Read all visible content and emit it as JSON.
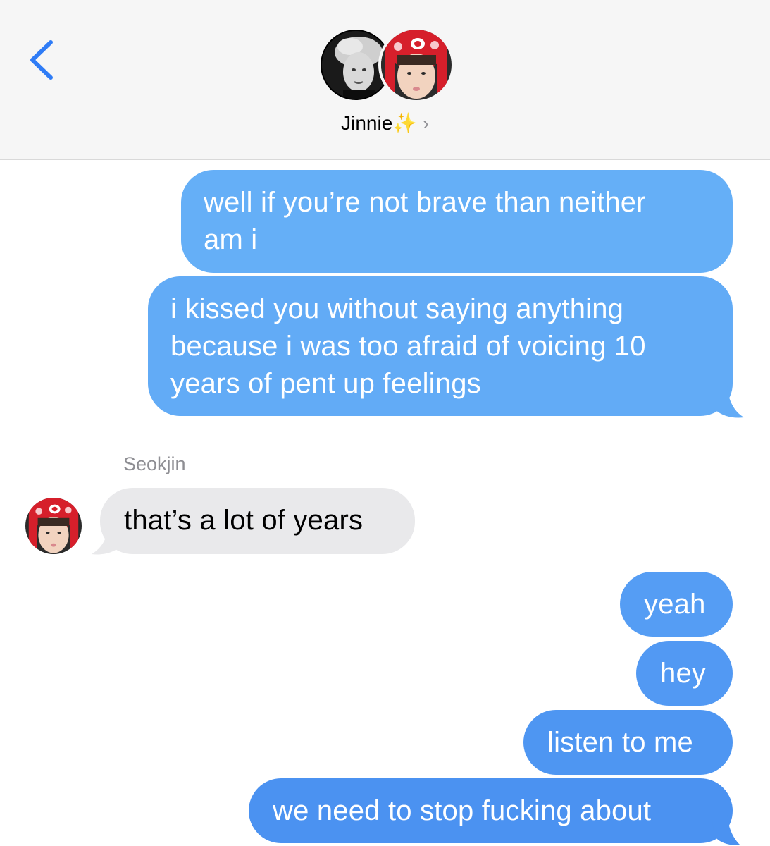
{
  "header": {
    "contact_name": "Jinnie",
    "contact_emoji": "✨",
    "chevron": "›",
    "back_icon": "chevron-left-icon",
    "accent_color": "#2f7cf6"
  },
  "messages": [
    {
      "direction": "outgoing",
      "lines": [
        "well if you’re not brave than neither",
        "am i"
      ],
      "color": "#65aff7"
    },
    {
      "direction": "outgoing",
      "lines": [
        "i kissed you without saying anything",
        "because i was too afraid of voicing 10",
        "years of pent up feelings"
      ],
      "color": "#62abf6"
    },
    {
      "direction": "incoming",
      "sender": "Seokjin",
      "lines": [
        "that’s a lot of years"
      ]
    },
    {
      "direction": "outgoing",
      "lines": [
        "yeah"
      ],
      "color": "#559df4"
    },
    {
      "direction": "outgoing",
      "lines": [
        "hey"
      ],
      "color": "#5299f3"
    },
    {
      "direction": "outgoing",
      "lines": [
        "listen to me"
      ],
      "color": "#4e96f2"
    },
    {
      "direction": "outgoing",
      "lines": [
        "we need to stop fucking about"
      ],
      "color": "#4b92f1"
    }
  ],
  "incoming_bubble_color": "#e9e9eb",
  "sender_label": "Seokjin"
}
